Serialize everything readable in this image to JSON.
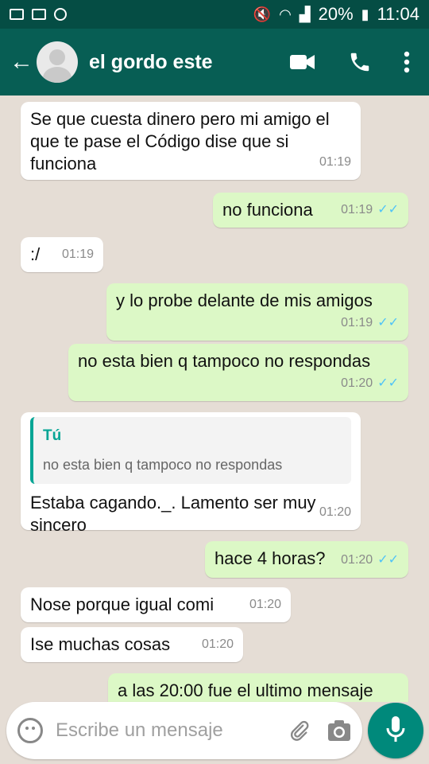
{
  "status_bar": {
    "battery": "20%",
    "time": "11:04"
  },
  "header": {
    "contact_name": "el gordo este"
  },
  "messages": [
    {
      "text": "Se que cuesta dinero pero mi amigo el que te pase el Código dise que si funciona",
      "time": "01:19",
      "direction": "incoming"
    },
    {
      "text": "no funciona",
      "time": "01:19",
      "direction": "outgoing"
    },
    {
      "text": ":/",
      "time": "01:19",
      "direction": "incoming"
    },
    {
      "text": "y lo probe delante de mis amigos",
      "time": "01:19",
      "direction": "outgoing"
    },
    {
      "text": "no esta bien q tampoco no respondas",
      "time": "01:20",
      "direction": "outgoing"
    },
    {
      "quote_author": "Tú",
      "quote_text": "no esta bien q tampoco no respondas",
      "text": "Estaba cagando._. Lamento ser muy sincero",
      "time": "01:20",
      "direction": "incoming"
    },
    {
      "text": "hace 4 horas?",
      "time": "01:20",
      "direction": "outgoing"
    },
    {
      "text": "Nose porque igual comi",
      "time": "01:20",
      "direction": "incoming"
    },
    {
      "text": "Ise muchas cosas",
      "time": "01:20",
      "direction": "incoming"
    },
    {
      "text": "a las 20:00 fue el ultimo mensaje",
      "time": "",
      "direction": "outgoing"
    }
  ],
  "input": {
    "placeholder": "Escribe un mensaje"
  },
  "icons": {
    "read_ticks": "✓✓",
    "accent": "#075e54",
    "outgoing_bg": "#dcf8c6",
    "tick_color": "#4fc3f7"
  }
}
